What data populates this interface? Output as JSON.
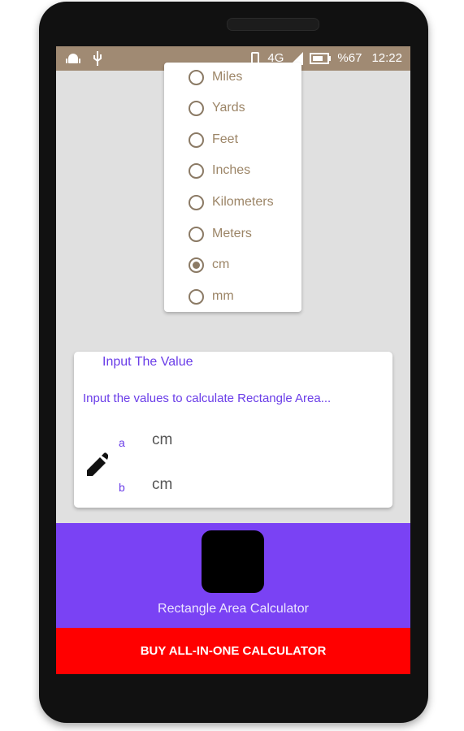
{
  "statusbar": {
    "battery": "%67",
    "time": "12:22",
    "network": "4G"
  },
  "units": {
    "items": [
      {
        "label": "Miles",
        "checked": false
      },
      {
        "label": "Yards",
        "checked": false
      },
      {
        "label": "Feet",
        "checked": false
      },
      {
        "label": "Inches",
        "checked": false
      },
      {
        "label": "Kilometers",
        "checked": false
      },
      {
        "label": "Meters",
        "checked": false
      },
      {
        "label": "cm",
        "checked": true
      },
      {
        "label": "mm",
        "checked": false
      }
    ]
  },
  "input_card": {
    "title": "Input The Value",
    "description": "Input the values to calculate Rectangle Area...",
    "fields": [
      {
        "label": "a",
        "unit": "cm"
      },
      {
        "label": "b",
        "unit": "cm"
      }
    ]
  },
  "promo": {
    "app_name": "Rectangle Area Calculator"
  },
  "buy_button": {
    "label": "BUY ALL-IN-ONE CALCULATOR"
  },
  "colors": {
    "accent": "#6a3de8",
    "promo_bg": "#7a42f4",
    "buy_bg": "#ff0000",
    "statusbar_bg": "#a08a73",
    "radio": "#8b7a65"
  },
  "icons": [
    "android-icon",
    "usb-icon",
    "vibrate-icon",
    "signal-icon",
    "battery-icon",
    "pencil-icon"
  ]
}
